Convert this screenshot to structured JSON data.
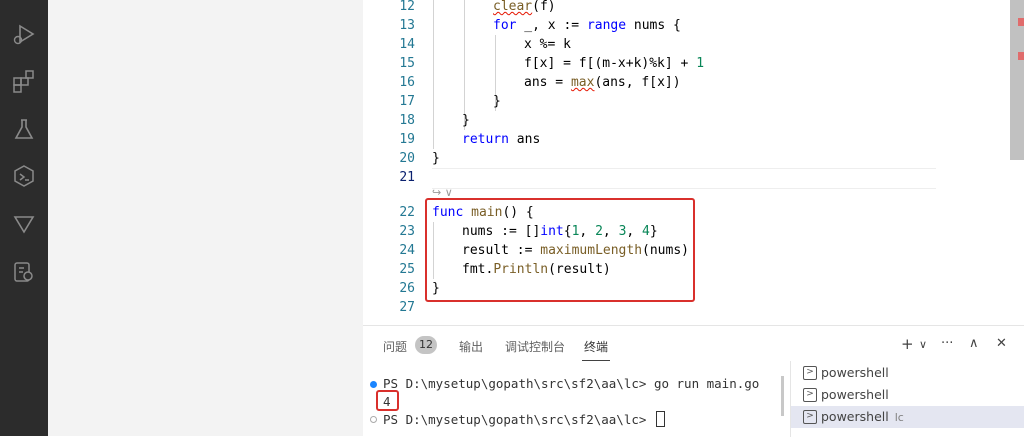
{
  "editor": {
    "line_numbers": [
      "12",
      "13",
      "14",
      "15",
      "16",
      "17",
      "18",
      "19",
      "20",
      "21",
      "22",
      "23",
      "24",
      "25",
      "26",
      "27"
    ],
    "lines": {
      "l12": {
        "fn": "clear",
        "rest": "(f)"
      },
      "l13": {
        "kw1": "for",
        "mid": " _, x := ",
        "kw2": "range",
        "rest": " nums {"
      },
      "l14": {
        "text": "x %= k"
      },
      "l15": {
        "pre": "f[x] = f[(m-x+k)%k] + ",
        "num": "1"
      },
      "l16": {
        "pre": "ans = ",
        "fn": "max",
        "rest": "(ans, f[x])"
      },
      "l17": {
        "text": "}"
      },
      "l18": {
        "text": "}"
      },
      "l19": {
        "kw": "return",
        "rest": " ans"
      },
      "l20": {
        "text": "}"
      },
      "l22": {
        "kw": "func",
        "fn": " main",
        "rest": "() {"
      },
      "l23": {
        "pre": "nums := []",
        "kw": "int",
        "open": "{",
        "n1": "1",
        "c1": ", ",
        "n2": "2",
        "c2": ", ",
        "n3": "3",
        "c3": ", ",
        "n4": "4",
        "close": "}"
      },
      "l24": {
        "pre": "result := ",
        "fn": "maximumLength",
        "rest": "(nums)"
      },
      "l25": {
        "pre": "fmt.",
        "fn": "Println",
        "rest": "(result)"
      },
      "l26": {
        "text": "}"
      }
    },
    "codelens": "↪ ∨"
  },
  "panel": {
    "tabs": [
      {
        "label": "问题"
      },
      {
        "label": "输出"
      },
      {
        "label": "调试控制台"
      },
      {
        "label": "终端"
      }
    ],
    "problems_count": "12",
    "actions": {
      "add": "+",
      "dropdown": "∨",
      "more": "···",
      "maximize": "∧",
      "close": "✕"
    },
    "terminal": {
      "line1_prompt": "PS D:\\mysetup\\gopath\\src\\sf2\\aa\\lc> ",
      "line1_cmd": "go run main.go",
      "output": "4",
      "line3_prompt": "PS D:\\mysetup\\gopath\\src\\sf2\\aa\\lc> "
    },
    "terminal_list": [
      {
        "label": "powershell",
        "suffix": ""
      },
      {
        "label": "powershell",
        "suffix": ""
      },
      {
        "label": "powershell",
        "suffix": "lc"
      }
    ]
  },
  "colors": {
    "highlight": "#d9302c",
    "activity_bar": "#2c2c2c",
    "sidebar": "#f3f3f3"
  }
}
